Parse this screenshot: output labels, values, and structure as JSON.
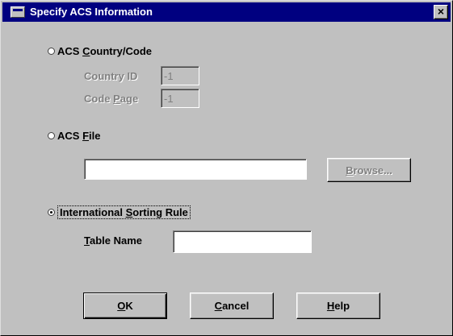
{
  "window": {
    "title": "Specify ACS Information",
    "close_glyph": "×"
  },
  "options": {
    "acs_country_code": {
      "label_pre": "ACS ",
      "label_mnemonic": "C",
      "label_post": "ountry/Code",
      "checked": false
    },
    "acs_file": {
      "label_pre": "ACS ",
      "label_mnemonic": "F",
      "label_post": "ile",
      "checked": false
    },
    "international_sorting_rule": {
      "label_pre": "International ",
      "label_mnemonic": "S",
      "label_post": "orting Rule",
      "checked": true
    }
  },
  "country_code": {
    "country_id_label": "Country ID",
    "country_id_value": "-1",
    "code_page_label_pre": "Code ",
    "code_page_label_mnemonic": "P",
    "code_page_label_post": "age",
    "code_page_value": "-1"
  },
  "acs_file": {
    "path_value": "",
    "browse_label_mnemonic": "B",
    "browse_label_post": "rowse..."
  },
  "sorting": {
    "table_name_label_mnemonic": "T",
    "table_name_label_post": "able Name",
    "table_name_value": ""
  },
  "buttons": {
    "ok_mnemonic": "O",
    "ok_post": "K",
    "cancel_mnemonic": "C",
    "cancel_post": "ancel",
    "help_mnemonic": "H",
    "help_post": "elp"
  },
  "icons": {
    "title_icon": "window-icon",
    "close_icon": "close-icon"
  }
}
